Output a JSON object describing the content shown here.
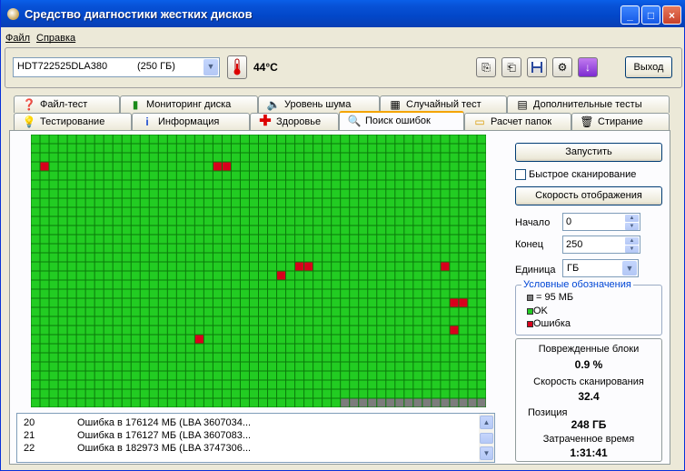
{
  "window": {
    "title": "Средство диагностики жестких дисков",
    "minimize": "_",
    "maximize": "□",
    "close": "×"
  },
  "menu": {
    "file": "Файл",
    "help": "Справка"
  },
  "toolbar": {
    "drive_model": "HDT722525DLA380",
    "drive_size": "(250 ГБ)",
    "temperature": "44°C",
    "exit_label": "Выход"
  },
  "tabs_top": [
    "Файл-тест",
    "Мониторинг диска",
    "Уровень шума",
    "Случайный тест",
    "Дополнительные тесты"
  ],
  "tabs_bottom": [
    "Тестирование",
    "Информация",
    "Здоровье",
    "Поиск ошибок",
    "Расчет папок",
    "Стирание"
  ],
  "active_tab": "Поиск ошибок",
  "scan_map": {
    "columns": 50,
    "rows": 30,
    "colors": {
      "ok": "#22cc22",
      "error": "#d8001c",
      "pending": "#7c7c7c",
      "grid": "#0a7a0a"
    },
    "error_cells": [
      [
        1,
        3
      ],
      [
        20,
        3
      ],
      [
        21,
        3
      ],
      [
        29,
        14
      ],
      [
        30,
        14
      ],
      [
        45,
        14
      ],
      [
        27,
        15
      ],
      [
        46,
        18
      ],
      [
        47,
        18
      ],
      [
        46,
        21
      ],
      [
        18,
        22
      ]
    ],
    "pending_from": {
      "row": 29,
      "col": 34
    }
  },
  "log": [
    {
      "n": "20",
      "text": "Ошибка в 176124 МБ (LBA 3607034..."
    },
    {
      "n": "21",
      "text": "Ошибка в 176127 МБ (LBA 3607083..."
    },
    {
      "n": "22",
      "text": "Ошибка в 182973 МБ (LBA 3747306..."
    }
  ],
  "controls": {
    "run": "Запустить",
    "quick_scan": "Быстрое сканирование",
    "display_speed": "Скорость отображения",
    "start_label": "Начало",
    "start_value": "0",
    "end_label": "Конец",
    "end_value": "250",
    "unit_label": "Единица",
    "unit_value": "ГБ"
  },
  "legend": {
    "title": "Условные обозначения",
    "block": "= 95 МБ",
    "ok": "OK",
    "error": "Ошибка"
  },
  "stats": {
    "damaged_label": "Поврежденные блоки",
    "damaged_value": "0.9 %",
    "speed_label": "Скорость сканирования",
    "speed_value": "32.4",
    "position_label": "Позиция",
    "position_value": "248 ГБ",
    "elapsed_label": "Затраченное время",
    "elapsed_value": "1:31:41"
  }
}
